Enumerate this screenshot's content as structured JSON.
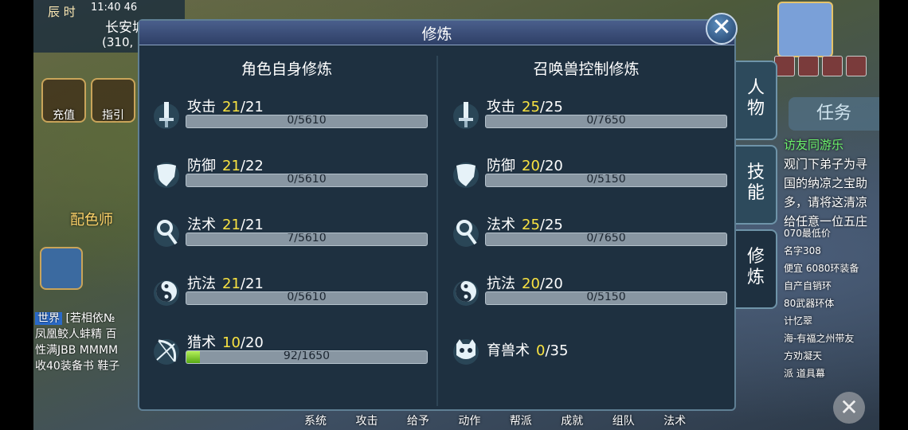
{
  "hud": {
    "time_label": "辰 时",
    "clock": "11:40 46",
    "map_name": "长安城",
    "coords": "(310,",
    "recharge": "充值",
    "guide": "指引",
    "dye_npc": "配色师",
    "chat_channel": "世界",
    "chat_lines": [
      "[若相依№",
      "凤凰鲛人蚌精 百",
      "性满JBB MMMM",
      "收40装备书 鞋子"
    ],
    "task_tab": "任务",
    "quest_lines": [
      "访友同游乐",
      "观门下弟子为寻",
      "国的纳凉之宝助",
      "多，请将这清凉",
      "给任意一位五庄"
    ],
    "market_lines": [
      "070最低价",
      "名字308",
      "便宜 6080环装备",
      "自产自销环",
      "80武器环体",
      "计忆翠",
      "海-有福之州带友",
      "方劝凝天",
      "派 道具幕"
    ],
    "bottom_menu": [
      "系统",
      "攻击",
      "给予",
      "动作",
      "帮派",
      "成就",
      "组队",
      "法术"
    ]
  },
  "panel": {
    "title": "修炼",
    "close": "✕",
    "left": {
      "header": "角色自身修炼",
      "rows": [
        {
          "name": "攻击",
          "cur": "21",
          "max": "/21",
          "progress": "0/5610",
          "fill": 0
        },
        {
          "name": "防御",
          "cur": "21",
          "max": "/22",
          "progress": "0/5610",
          "fill": 0
        },
        {
          "name": "法术",
          "cur": "21",
          "max": "/21",
          "progress": "7/5610",
          "fill": 0.001
        },
        {
          "name": "抗法",
          "cur": "21",
          "max": "/21",
          "progress": "0/5610",
          "fill": 0
        },
        {
          "name": "猎术",
          "cur": "10",
          "max": "/20",
          "progress": "92/1650",
          "fill": 0.056
        }
      ]
    },
    "right": {
      "header": "召唤兽控制修炼",
      "rows": [
        {
          "name": "攻击",
          "cur": "25",
          "max": "/25",
          "progress": "0/7650",
          "fill": 0
        },
        {
          "name": "防御",
          "cur": "20",
          "max": "/20",
          "progress": "0/5150",
          "fill": 0
        },
        {
          "name": "法术",
          "cur": "25",
          "max": "/25",
          "progress": "0/7650",
          "fill": 0
        },
        {
          "name": "抗法",
          "cur": "20",
          "max": "/20",
          "progress": "0/5150",
          "fill": 0
        },
        {
          "name": "育兽术",
          "cur": "0",
          "max": "/35"
        }
      ]
    },
    "tabs": [
      {
        "label": "人\n物"
      },
      {
        "label": "技\n能"
      },
      {
        "label": "修\n炼"
      }
    ]
  },
  "colors": {
    "level_current": "#f9e341",
    "panel_bg": "#1e3040",
    "bar_fill": "#57a814"
  }
}
